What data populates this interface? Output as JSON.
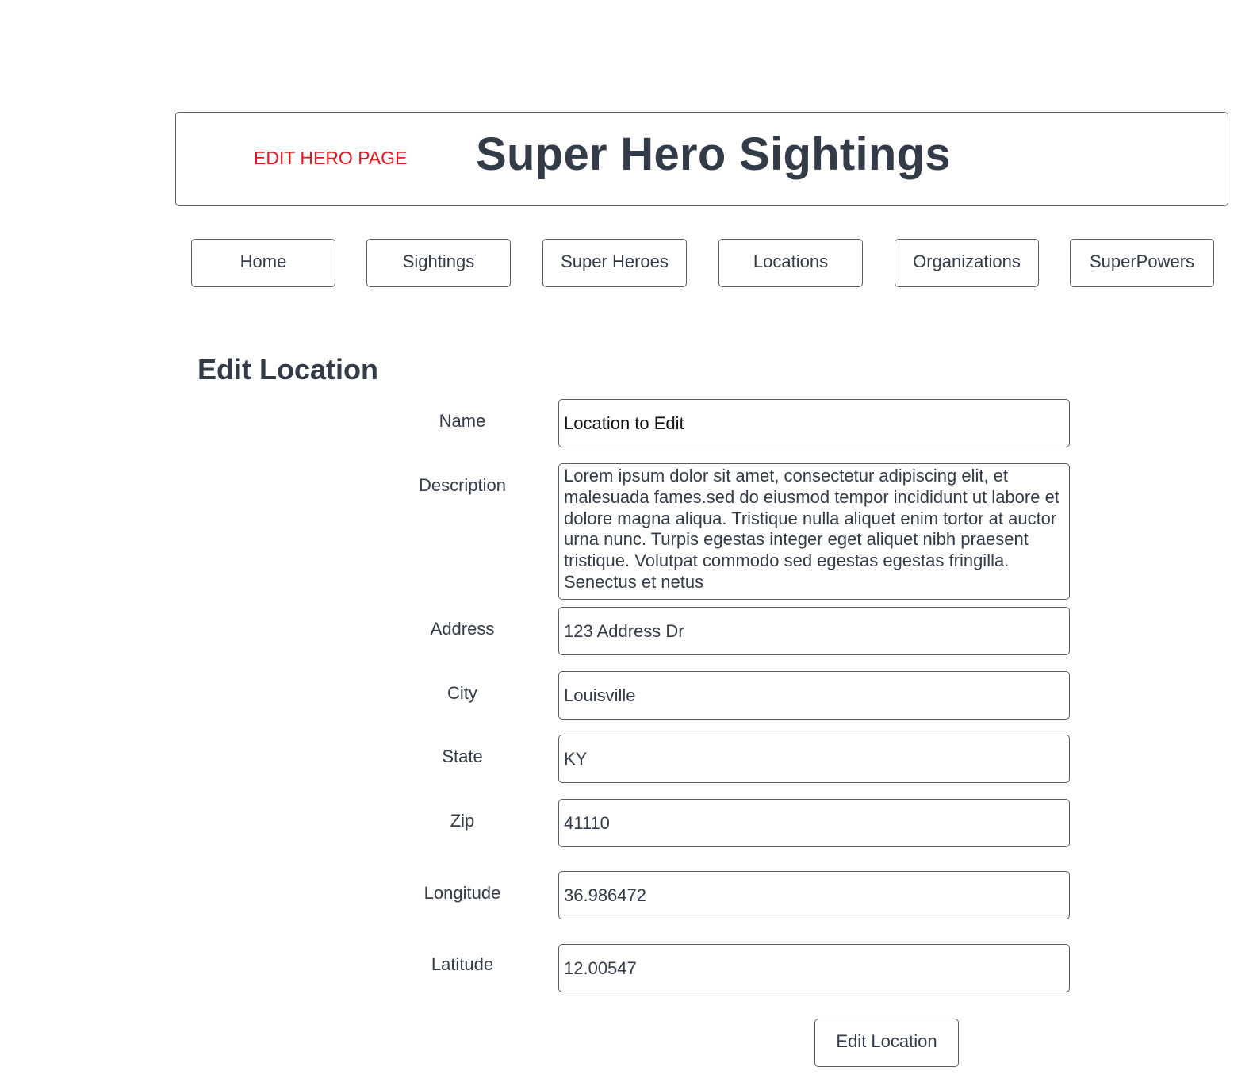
{
  "header": {
    "page_tag": "EDIT HERO PAGE",
    "site_title": "Super Hero Sightings"
  },
  "nav": {
    "items": [
      {
        "label": "Home"
      },
      {
        "label": "Sightings"
      },
      {
        "label": "Super Heroes"
      },
      {
        "label": "Locations"
      },
      {
        "label": "Organizations"
      },
      {
        "label": "SuperPowers"
      }
    ]
  },
  "form": {
    "title": "Edit Location",
    "name": {
      "label": "Name",
      "value": "Location to Edit"
    },
    "description": {
      "label": "Description",
      "value": "Lorem ipsum dolor sit amet, consectetur adipiscing elit, et malesuada fames.sed do eiusmod tempor incididunt ut labore et dolore magna aliqua. Tristique nulla aliquet enim tortor at auctor urna nunc. Turpis egestas integer eget aliquet nibh praesent tristique. Volutpat commodo sed egestas egestas fringilla. Senectus et netus"
    },
    "address": {
      "label": "Address",
      "value": "123 Address Dr"
    },
    "city": {
      "label": "City",
      "value": "Louisville"
    },
    "state": {
      "label": "State",
      "value": "KY"
    },
    "zip": {
      "label": "Zip",
      "value": "41110"
    },
    "longitude": {
      "label": "Longitude",
      "value": "36.986472"
    },
    "latitude": {
      "label": "Latitude",
      "value": "12.00547"
    },
    "submit_label": "Edit Location"
  },
  "colors": {
    "text": "#333b48",
    "page_tag": "#e3151a",
    "border": "#5a5f66"
  }
}
